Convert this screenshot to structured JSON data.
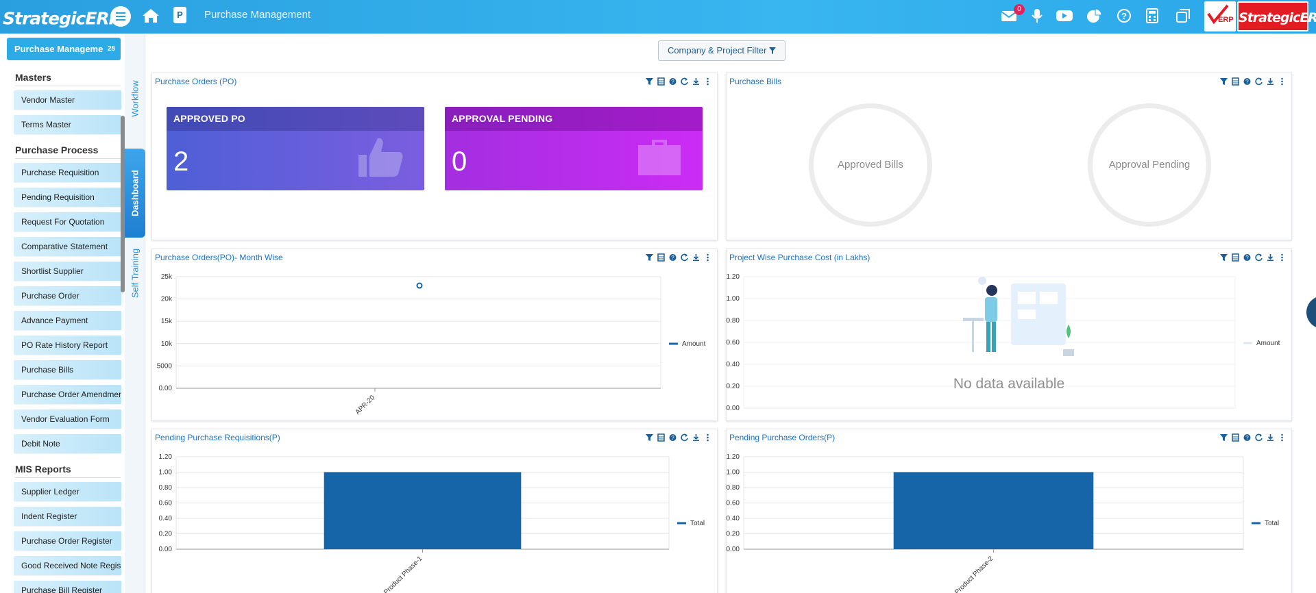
{
  "topbar": {
    "logo_text": "StrategicERP",
    "logo_reg": "®",
    "page_badge": "P",
    "title": "Purchase Management",
    "mail_count": "0",
    "brand_text": "StrategicERP",
    "icons": [
      "mail-icon",
      "mic-icon",
      "youtube-icon",
      "pie-chart-icon",
      "help-icon",
      "calculator-icon",
      "windows-icon"
    ]
  },
  "sidebar": {
    "module_label": "Purchase Manageme",
    "module_count": "28",
    "sections": [
      {
        "title": "Masters",
        "items": [
          "Vendor Master",
          "Terms Master"
        ]
      },
      {
        "title": "Purchase Process",
        "items": [
          "Purchase Requisition",
          "Pending Requisition",
          "Request For Quotation",
          "Comparative Statement",
          "Shortlist Supplier",
          "Purchase Order",
          "Advance Payment",
          "PO Rate History Report",
          "Purchase Bills",
          "Purchase Order Amendment",
          "Vendor Evaluation Form",
          "Debit Note"
        ]
      },
      {
        "title": "MIS Reports",
        "items": [
          "Supplier Ledger",
          "Indent Register",
          "Purchase Order Register",
          "Good Received Note Regis..",
          "Purchase Bill Register"
        ]
      }
    ]
  },
  "vtabs": {
    "workflow": "Workflow",
    "dashboard": "Dashboard",
    "training": "Self Training"
  },
  "filter_button": "Company & Project Filter",
  "panels": {
    "po": {
      "title": "Purchase Orders (PO)",
      "kpis": [
        {
          "label": "APPROVED PO",
          "value": "2",
          "icon": "thumbs-up-icon"
        },
        {
          "label": "APPROVAL PENDING",
          "value": "0",
          "icon": "briefcase-icon"
        }
      ]
    },
    "bills": {
      "title": "Purchase Bills",
      "rings": [
        "Approved Bills",
        "Approval Pending"
      ]
    },
    "month": {
      "title": "Purchase Orders(PO)- Month Wise"
    },
    "project_cost": {
      "title": "Project Wise Purchase Cost (in Lakhs)",
      "no_data": "No data available",
      "legend": "Amount"
    },
    "pending_req": {
      "title": "Pending Purchase Requisitions(P)"
    },
    "pending_po": {
      "title": "Pending Purchase Orders(P)"
    }
  },
  "chart_data": [
    {
      "type": "line",
      "title": "Purchase Orders(PO)- Month Wise",
      "categories": [
        "APR-20"
      ],
      "series": [
        {
          "name": "Amount",
          "values": [
            23000
          ]
        }
      ],
      "yticks": [
        "0.00",
        "5000",
        "10k",
        "15k",
        "20k",
        "25k"
      ],
      "ylim": [
        0,
        25000
      ],
      "legend": "right",
      "color": "#1565a8"
    },
    {
      "type": "line",
      "title": "Project Wise Purchase Cost (in Lakhs)",
      "categories": [],
      "series": [
        {
          "name": "Amount",
          "values": []
        }
      ],
      "yticks": [
        "0.00",
        "0.20",
        "0.40",
        "0.60",
        "0.80",
        "1.00",
        "1.20"
      ],
      "ylim": [
        0,
        1.2
      ],
      "legend": "right"
    },
    {
      "type": "bar",
      "title": "Pending Purchase Requisitions(P)",
      "categories": [
        "Product Phase-1"
      ],
      "series": [
        {
          "name": "Total",
          "values": [
            1
          ]
        }
      ],
      "yticks": [
        "0.00",
        "0.20",
        "0.40",
        "0.60",
        "0.80",
        "1.00",
        "1.20"
      ],
      "ylim": [
        0,
        1.2
      ],
      "legend": "right",
      "color": "#1565a8"
    },
    {
      "type": "bar",
      "title": "Pending Purchase Orders(P)",
      "categories": [
        "Product Phase-2"
      ],
      "series": [
        {
          "name": "Total",
          "values": [
            1
          ]
        }
      ],
      "yticks": [
        "0.00",
        "0.20",
        "0.40",
        "0.60",
        "0.80",
        "1.00",
        "1.20"
      ],
      "ylim": [
        0,
        1.2
      ],
      "legend": "right",
      "color": "#1565a8"
    }
  ]
}
